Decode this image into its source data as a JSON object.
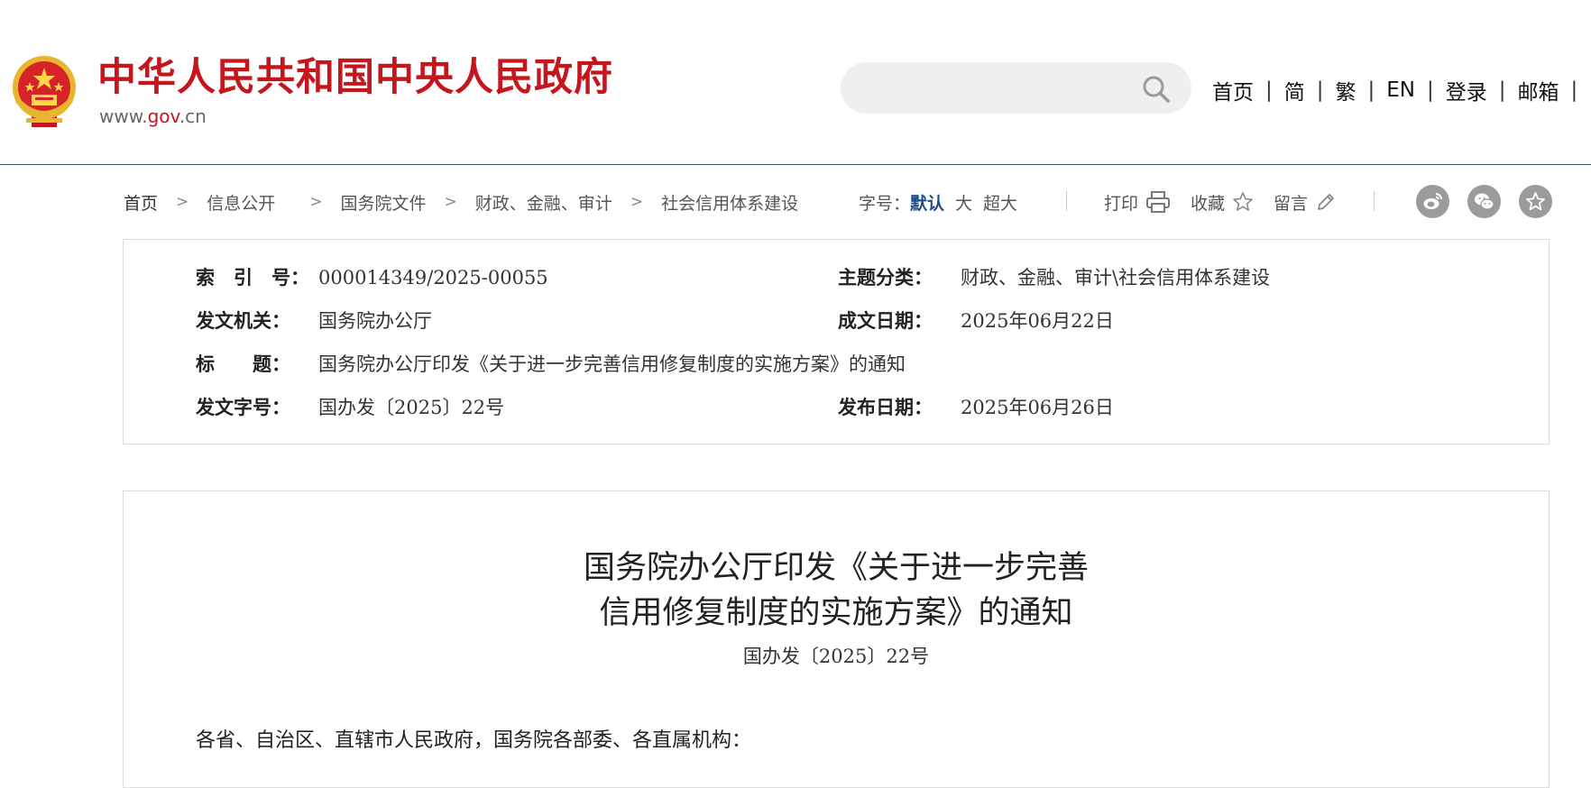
{
  "header": {
    "site_name": "中华人民共和国中央人民政府",
    "site_url_prefix": "www.",
    "site_url_mid": "gov",
    "site_url_suffix": ".cn",
    "search": {
      "placeholder": "",
      "value": ""
    },
    "nav": [
      {
        "label": "首页"
      },
      {
        "label": "简"
      },
      {
        "label": "繁"
      },
      {
        "label": "EN"
      },
      {
        "label": "登录"
      },
      {
        "label": "邮箱"
      }
    ],
    "nav_separator": "|"
  },
  "breadcrumb": [
    "首页",
    "信息公开",
    "国务院文件",
    "财政、金融、审计",
    "社会信用体系建设"
  ],
  "breadcrumb_separator": ">",
  "font_size": {
    "label": "字号：",
    "options": [
      "默认",
      "大",
      "超大"
    ],
    "active": "默认"
  },
  "tools": {
    "print_label": "打印",
    "favorite_label": "收藏",
    "comment_label": "留言"
  },
  "share_icons": [
    "weibo-icon",
    "wechat-icon",
    "star-share-icon"
  ],
  "metadata": {
    "index_label": "索　引　号：",
    "index_value": "000014349/2025-00055",
    "topic_label": "主题分类：",
    "topic_value": "财政、金融、审计\\社会信用体系建设",
    "issuer_label": "发文机关：",
    "issuer_value": "国务院办公厅",
    "created_label": "成文日期：",
    "created_value": "2025年06月22日",
    "title_label": "标　　题：",
    "title_value": "国务院办公厅印发《关于进一步完善信用修复制度的实施方案》的通知",
    "docno_label": "发文字号：",
    "docno_value": "国办发〔2025〕22号",
    "published_label": "发布日期：",
    "published_value": "2025年06月26日"
  },
  "article": {
    "title_line1": "国务院办公厅印发《关于进一步完善",
    "title_line2": "信用修复制度的实施方案》的通知",
    "doc_number": "国办发〔2025〕22号",
    "salutation": "各省、自治区、直辖市人民政府，国务院各部委、各直属机构："
  },
  "colors": {
    "brand_red": "#c4161c",
    "header_rule": "#3f5a74",
    "active_font_option": "#1c4c8a",
    "share_icon_bg": "#9b9b9b"
  }
}
